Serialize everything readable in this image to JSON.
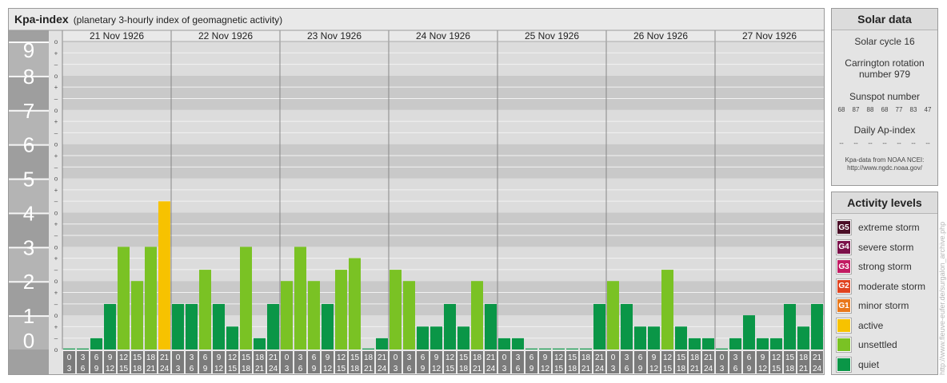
{
  "title": "Kpa-index",
  "subtitle": "(planetary 3-hourly index of geomagnetic activity)",
  "chart_data": {
    "type": "bar",
    "title": "Kpa-index",
    "subtitle": "(planetary 3-hourly index of geomagnetic activity)",
    "xlabel": "",
    "ylabel": "",
    "ylim": [
      0,
      9
    ],
    "y_ticks": [
      "0",
      "1",
      "2",
      "3",
      "4",
      "5",
      "6",
      "7",
      "8",
      "9"
    ],
    "y_minor_ticks": [
      "o",
      "+",
      "–"
    ],
    "days": [
      "21 Nov 1926",
      "22 Nov 1926",
      "23 Nov 1926",
      "24 Nov 1926",
      "25 Nov 1926",
      "26 Nov 1926",
      "27 Nov 1926"
    ],
    "intervals": [
      [
        "0",
        "3"
      ],
      [
        "3",
        "6"
      ],
      [
        "6",
        "9"
      ],
      [
        "9",
        "12"
      ],
      [
        "12",
        "15"
      ],
      [
        "15",
        "18"
      ],
      [
        "18",
        "21"
      ],
      [
        "21",
        "24"
      ]
    ],
    "series": [
      {
        "values": [
          0,
          0,
          0.33,
          1.33,
          3,
          2,
          3,
          4.33,
          1.33,
          1.33,
          2.33,
          1.33,
          0.67,
          3,
          0.33,
          1.33,
          2,
          3,
          2,
          1.33,
          2.33,
          2.67,
          0,
          0.33,
          2.33,
          2,
          0.67,
          0.67,
          1.33,
          0.67,
          2,
          1.33,
          0.33,
          0.33,
          0,
          0,
          0,
          0,
          0,
          1.33,
          2,
          1.33,
          0.67,
          0.67,
          2.33,
          0.67,
          0.33,
          0.33,
          0,
          0.33,
          1,
          0.33,
          0.33,
          1.33,
          0.67,
          1.33
        ]
      }
    ],
    "colors": {
      "quiet": "#0a9647",
      "unsettled": "#7ac224",
      "active": "#f7c200",
      "band_dark": "#c9c9c9",
      "band_light": "#dcdcdc",
      "axis_label_bg": "#a0a0a0",
      "tick_box": "#7b7b7b"
    },
    "grid": true
  },
  "solar": {
    "title": "Solar data",
    "cycle": "Solar cycle 16",
    "carrington_1": "Carrington rotation",
    "carrington_2": "number 979",
    "sunspot_label": "Sunspot number",
    "sunspots": [
      "68",
      "87",
      "88",
      "68",
      "77",
      "83",
      "47"
    ],
    "ap_label": "Daily Ap-index",
    "ap": [
      "--",
      "--",
      "--",
      "--",
      "--",
      "--",
      "--"
    ],
    "source_1": "Kpa-data from NOAA NCEI:",
    "source_2": "http://www.ngdc.noaa.gov/"
  },
  "activity": {
    "title": "Activity levels",
    "levels": [
      {
        "badge": "G5",
        "label": "extreme storm",
        "color": "#4a0e26"
      },
      {
        "badge": "G4",
        "label": "severe storm",
        "color": "#7b1049"
      },
      {
        "badge": "G3",
        "label": "strong storm",
        "color": "#c21b62"
      },
      {
        "badge": "G2",
        "label": "moderate storm",
        "color": "#e0431f"
      },
      {
        "badge": "G1",
        "label": "minor storm",
        "color": "#e9781b"
      },
      {
        "badge": "",
        "label": "active",
        "color": "#f7c200"
      },
      {
        "badge": "",
        "label": "unsettled",
        "color": "#7ac224"
      },
      {
        "badge": "",
        "label": "quiet",
        "color": "#0a9647"
      }
    ]
  },
  "watermark": "http://www.fleuve-eufer.de/surgalon_archive.php"
}
